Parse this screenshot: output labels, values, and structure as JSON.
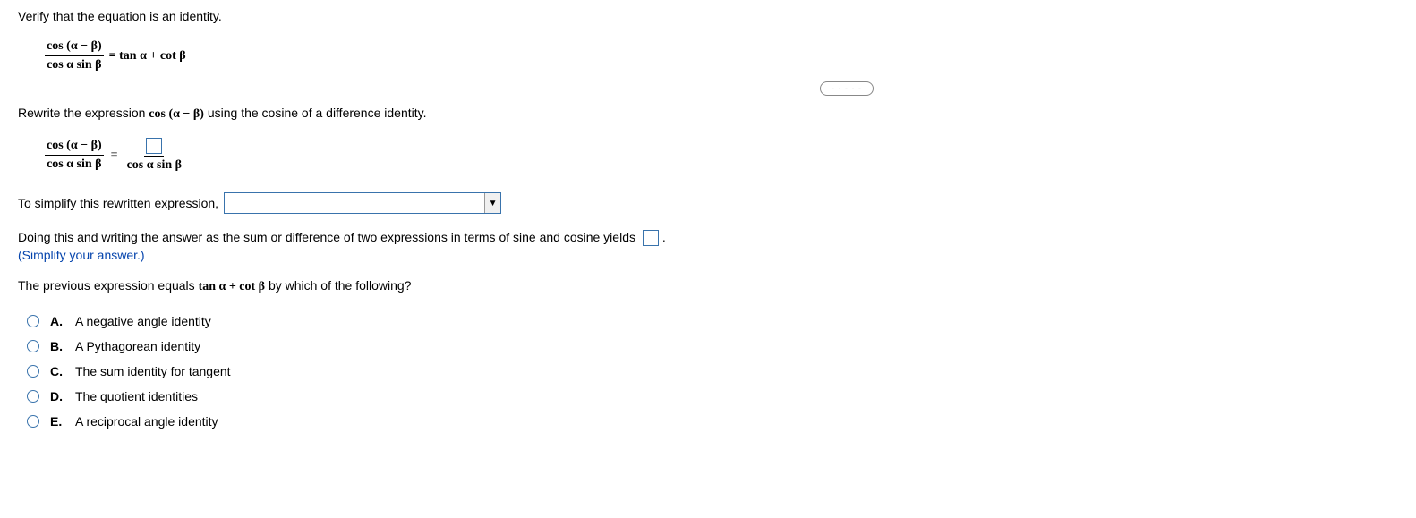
{
  "instruction": "Verify that the equation is an identity.",
  "equation": {
    "lhs_num": "cos (α − β)",
    "lhs_den": "cos α sin β",
    "rhs": "= tan α +  cot β"
  },
  "sub_instruction_pre": "Rewrite the expression ",
  "sub_instruction_bold": "cos (α − β)",
  "sub_instruction_post": " using the cosine of a difference identity.",
  "expr2": {
    "lhs_num": "cos (α − β)",
    "lhs_den": "cos α sin β",
    "rhs_den": "cos α sin β"
  },
  "simplify_text": "To simplify this rewritten expression,",
  "yields_text": "Doing this and writing the answer as the sum or difference of two expressions in terms of sine and cosine yields",
  "yields_period": ".",
  "hint_text": "(Simplify your answer.)",
  "question_pre": "The previous expression equals ",
  "question_bold": "tan α +  cot β",
  "question_post": " by which of the following?",
  "options": [
    {
      "letter": "A.",
      "text": "A negative angle identity"
    },
    {
      "letter": "B.",
      "text": "A Pythagorean identity"
    },
    {
      "letter": "C.",
      "text": "The sum identity for tangent"
    },
    {
      "letter": "D.",
      "text": "The quotient identities"
    },
    {
      "letter": "E.",
      "text": "A reciprocal angle identity"
    }
  ],
  "pill": "- - - - -"
}
